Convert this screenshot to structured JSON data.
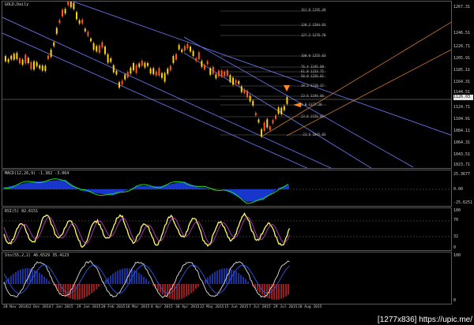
{
  "main": {
    "title": "GOLD,Daily",
    "price_axis": [
      "1267.31",
      "1246.51",
      "1226.71",
      "1205.91",
      "1185.11",
      "1164.31",
      "1144.51",
      "1124.71",
      "1104.91",
      "1084.11",
      "1064.31",
      "1043.51",
      "1023.71"
    ],
    "current_price": "1126.03",
    "fib_labels": [
      "161.8  1295.49",
      "138.2  1284.93",
      "127.2  1276.70",
      "100.0  1255.63",
      "76.4  1245.08",
      "61.8  1233.75",
      "50.0  1226.81",
      "38.2  1210.37",
      "23.6  1194.06",
      "0.0  1177.38",
      "23.6  1156.03",
      "-23.6  1045.82"
    ]
  },
  "macd": {
    "title": "MACD(12,26,9) -1.382 -3.064",
    "axis": [
      "25.3677",
      "0.00",
      "-25.6251"
    ]
  },
  "rsi": {
    "title": "RSI(5) 82.6151",
    "axis": [
      "100",
      "70",
      "32",
      "0"
    ]
  },
  "stoch": {
    "title": "Sto(55,2,2) 46.6529 35.4123",
    "axis": [
      "100",
      "0"
    ]
  },
  "dates": [
    "20 Nov 2014",
    "12 Dec 2014",
    "7 Jan 2015",
    "29 Jan 2015",
    "20 Feb 2015",
    "16 Mar 2015",
    "8 Apr 2015",
    "30 Apr 2015",
    "22 May 2015",
    "15 Jun 2015",
    "7 Jul 2015",
    "29 Jul 2015",
    "20 Aug 2015"
  ],
  "watermark": "[1277x836] https://upic.me/",
  "colors": {
    "up_candle": "#ffd400",
    "down_candle": "#ff5a1a",
    "channel_blue": "#6f7dff",
    "channel_orange": "#d07a2a",
    "macd_hist": "#1f43ff",
    "macd_signal": "#20e020",
    "rsi_line": "#ffff66"
  }
}
